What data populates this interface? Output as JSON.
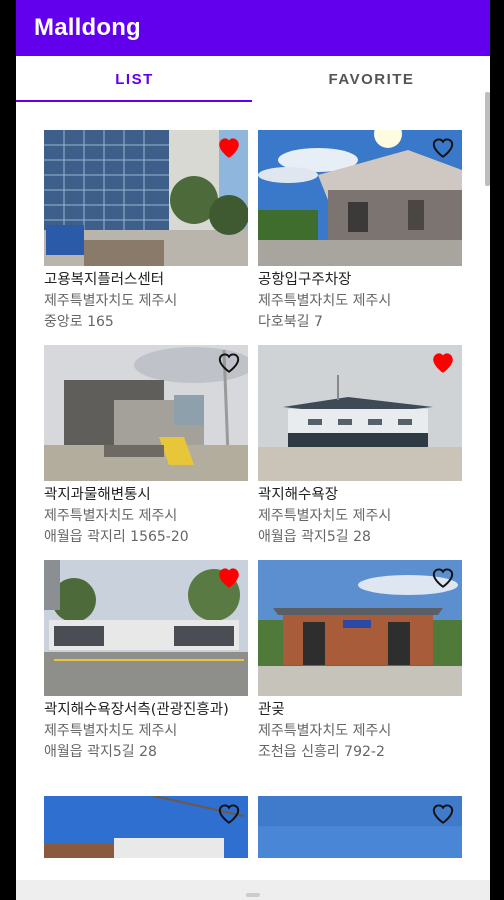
{
  "app": {
    "title": "Malldong"
  },
  "tabs": [
    {
      "label": "LIST",
      "active": true
    },
    {
      "label": "FAVORITE",
      "active": false
    }
  ],
  "colors": {
    "primary": "#6200ee",
    "favorite_red": "#ff0000"
  },
  "items": [
    {
      "name": "고용복지플러스센터",
      "addr1": "제주특별자치도 제주시",
      "addr2": "중앙로 165",
      "favorite": true,
      "icon": "heart-filled-icon"
    },
    {
      "name": "공항입구주차장",
      "addr1": "제주특별자치도 제주시",
      "addr2": "다호북길 7",
      "favorite": false,
      "icon": "heart-outline-icon"
    },
    {
      "name": "곽지과물해변통시",
      "addr1": "제주특별자치도 제주시",
      "addr2": "애월읍 곽지리 1565-20",
      "favorite": false,
      "icon": "heart-outline-icon"
    },
    {
      "name": "곽지해수욕장",
      "addr1": "제주특별자치도 제주시",
      "addr2": "애월읍 곽지5길 28",
      "favorite": true,
      "icon": "heart-filled-icon"
    },
    {
      "name": "곽지해수욕장서측(관광진흥과)",
      "addr1": "제주특별자치도 제주시",
      "addr2": "애월읍 곽지5길 28",
      "favorite": true,
      "icon": "heart-filled-icon"
    },
    {
      "name": "관곶",
      "addr1": "제주특별자치도 제주시",
      "addr2": "조천읍 신흥리 792-2",
      "favorite": false,
      "icon": "heart-outline-icon"
    },
    {
      "name": "",
      "addr1": "",
      "addr2": "",
      "favorite": false,
      "icon": "heart-outline-icon"
    },
    {
      "name": "",
      "addr1": "",
      "addr2": "",
      "favorite": false,
      "icon": "heart-outline-icon"
    }
  ]
}
